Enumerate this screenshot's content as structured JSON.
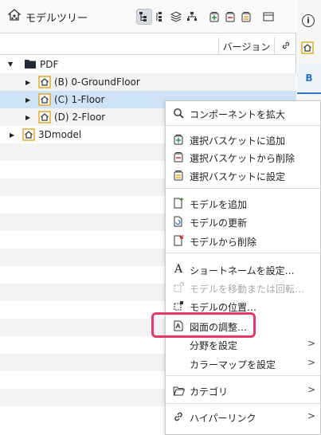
{
  "panel": {
    "title": "モデルツリー",
    "toolbar_icons": [
      "tree-view-icon",
      "list-tree-icon",
      "layers-icon",
      "hierarchy-icon",
      "add-basket-icon",
      "remove-basket-icon",
      "set-basket-icon",
      "window-icon"
    ],
    "columns": {
      "version": "バージョン",
      "link_icon": "link-icon"
    }
  },
  "tree": [
    {
      "label": "PDF",
      "icon": "folder-icon",
      "expanded": true
    },
    {
      "label": "(B) 0-GroundFloor",
      "icon": "house-icon"
    },
    {
      "label": "(C) 1-Floor",
      "icon": "house-icon",
      "selected": true
    },
    {
      "label": "(D) 2-Floor",
      "icon": "house-icon"
    },
    {
      "label": "3Dmodel",
      "icon": "house-icon"
    }
  ],
  "right_panel": {
    "tab_label": "B"
  },
  "context_menu": {
    "items": [
      {
        "label": "コンポーネントを拡大",
        "icon": "search-icon"
      },
      {
        "label": "選択バスケットに追加",
        "icon": "add-basket-icon"
      },
      {
        "label": "選択バスケットから削除",
        "icon": "remove-basket-icon"
      },
      {
        "label": "選択バスケットに設定",
        "icon": "set-basket-icon"
      },
      {
        "label": "モデルを追加",
        "icon": "add-model-icon"
      },
      {
        "label": "モデルの更新",
        "icon": "refresh-model-icon"
      },
      {
        "label": "モデルから削除",
        "icon": "delete-model-icon"
      },
      {
        "label": "ショートネームを設定…",
        "icon": "text-icon"
      },
      {
        "label": "モデルを移動または回転…",
        "icon": "move-icon",
        "disabled": true
      },
      {
        "label": "モデルの位置…",
        "icon": "position-icon"
      },
      {
        "label": "図面の調整…",
        "icon": "pdf-icon",
        "highlighted": true
      },
      {
        "label": "分野を設定",
        "icon": "",
        "submenu": true
      },
      {
        "label": "カラーマップを設定",
        "icon": "",
        "submenu": true
      },
      {
        "label": "カテゴリ",
        "icon": "folder-open-icon",
        "submenu": true
      },
      {
        "label": "ハイパーリンク",
        "icon": "hyperlink-icon",
        "submenu": true
      }
    ]
  },
  "colors": {
    "selection": "#cfe3f7",
    "highlight": "#e8386b",
    "accent": "#2f76c9",
    "icon_orange": "#e5a21c",
    "icon_green": "#2e9a48",
    "icon_red": "#d33"
  }
}
